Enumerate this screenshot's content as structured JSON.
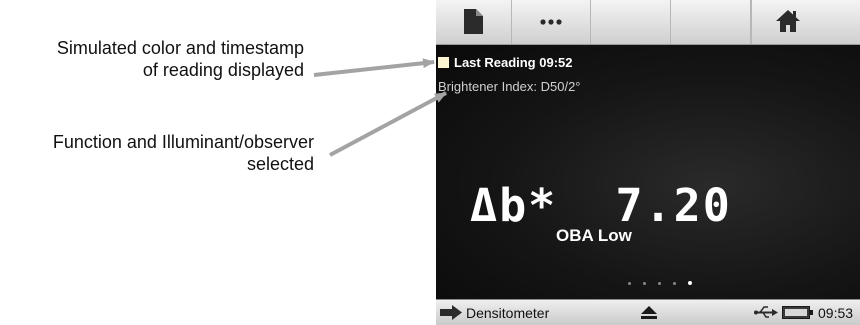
{
  "callouts": {
    "reading_line1": "Simulated color and timestamp",
    "reading_line2": "of reading displayed",
    "function_line1": "Function and Illuminant/observer",
    "function_line2": "selected"
  },
  "toolbar": {
    "icons": [
      "document-icon",
      "more-icon",
      "home-icon"
    ]
  },
  "screen": {
    "swatch_color": "#fbf4d2",
    "reading_label": "Last Reading 09:52",
    "function_label": "Brightener Index: D50/2°",
    "value_label": "Δb*  7.20",
    "oba_label": "OBA Low",
    "page_count": 5,
    "active_page": 5
  },
  "statusbar": {
    "mode_label": "Densitometer",
    "time": "09:53"
  }
}
